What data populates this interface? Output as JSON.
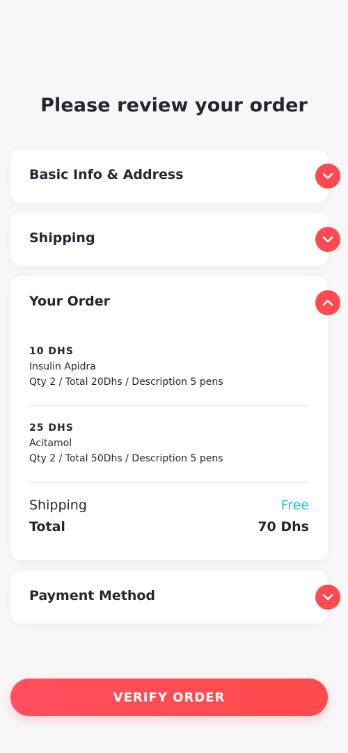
{
  "page": {
    "title": "Please review your order"
  },
  "sections": {
    "basic_info": {
      "label": "Basic Info & Address",
      "expanded": false
    },
    "shipping": {
      "label": "Shipping",
      "expanded": false
    },
    "your_order": {
      "label": "Your Order",
      "expanded": true
    },
    "payment_method": {
      "label": "Payment Method",
      "expanded": false
    }
  },
  "order": {
    "items": [
      {
        "price": "10 DHS",
        "name": "Insulin Apidra",
        "detail": "Qty 2 / Total 20Dhs / Description 5 pens"
      },
      {
        "price": "25 DHS",
        "name": "Acitamol",
        "detail": "Qty 2 / Total 50Dhs / Description 5 pens"
      }
    ],
    "shipping_label": "Shipping",
    "shipping_value": "Free",
    "total_label": "Total",
    "total_value": "70 Dhs"
  },
  "actions": {
    "verify_label": "VERIFY ORDER"
  },
  "colors": {
    "accent": "#ff4a52",
    "free_text": "#1ec6d8",
    "text": "#232733",
    "background": "#f7f7f8"
  },
  "icons": {
    "collapsed": "chevron-down-icon",
    "expanded": "chevron-up-icon"
  }
}
